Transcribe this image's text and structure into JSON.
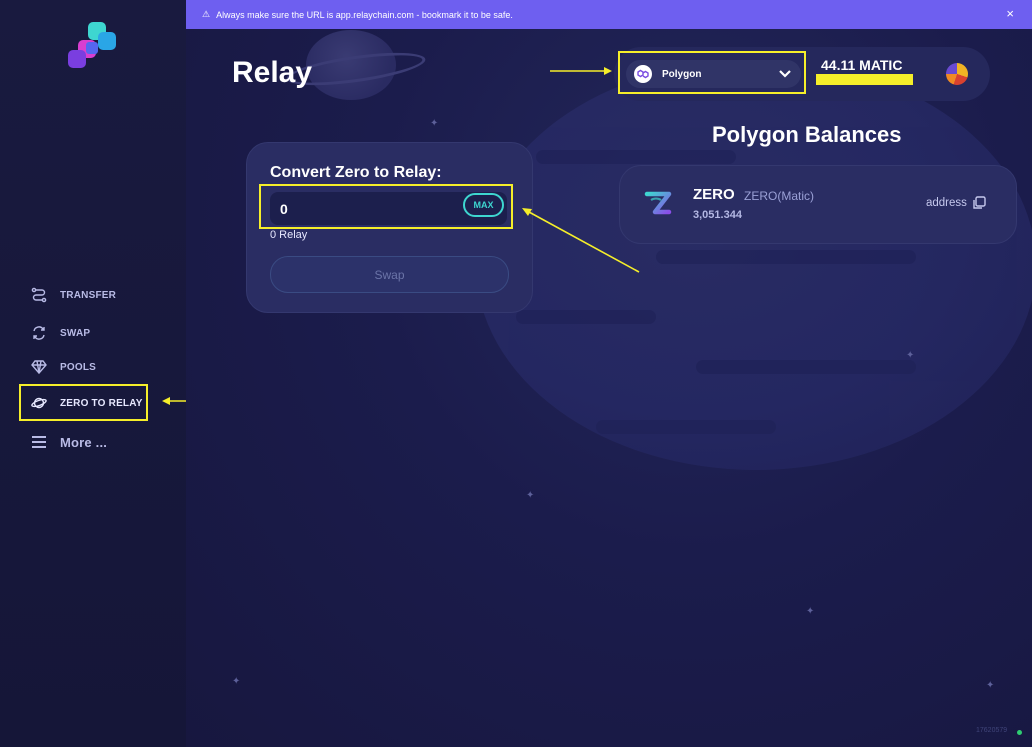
{
  "banner": {
    "text": "Always make sure the URL is app.relaychain.com - bookmark it to be safe.",
    "close": "×"
  },
  "sidebar": {
    "items": [
      {
        "label": "TRANSFER",
        "icon": "transfer-icon"
      },
      {
        "label": "SWAP",
        "icon": "swap-icon"
      },
      {
        "label": "POOLS",
        "icon": "diamond-icon"
      },
      {
        "label": "ZERO TO RELAY",
        "icon": "planet-icon"
      },
      {
        "label": "More ...",
        "icon": "hamburger-icon"
      }
    ]
  },
  "page": {
    "title": "Relay"
  },
  "header": {
    "network": "Polygon",
    "balance": "44.11 MATIC"
  },
  "convert": {
    "title": "Convert Zero to Relay:",
    "amount": "0",
    "max_label": "MAX",
    "output": "0 Relay",
    "swap_label": "Swap"
  },
  "balances": {
    "title": "Polygon Balances",
    "tokens": [
      {
        "symbol": "ZERO",
        "network_label": "ZERO(Matic)",
        "amount": "3,051.344",
        "address_label": "address"
      }
    ]
  },
  "footer": {
    "version": "17620579"
  },
  "colors": {
    "accent": "#3ed6d0",
    "banner": "#6e5ff0",
    "highlight": "#f5ee2a",
    "background": "#17173d"
  }
}
